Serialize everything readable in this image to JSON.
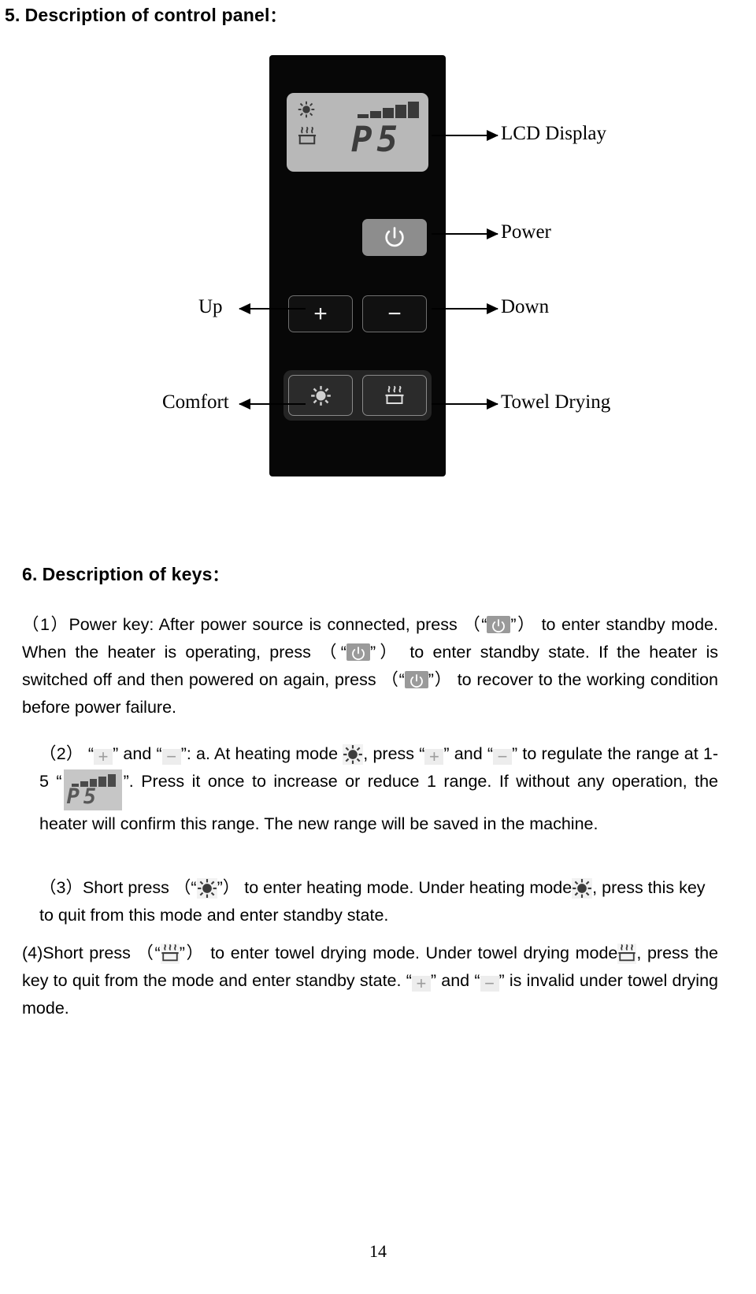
{
  "document": {
    "page_number": "14"
  },
  "sections": {
    "control_panel": {
      "number": "5.",
      "title": "Description of control panel",
      "colon": "：",
      "diagram": {
        "lcd": {
          "readout": "P5",
          "bar_levels": 5,
          "sun_icon": "sun-icon",
          "towel_icon": "towel-drying-icon"
        },
        "buttons": {
          "power": "power-icon",
          "up": "+",
          "down": "−",
          "comfort": "sun-icon",
          "towel": "towel-drying-icon"
        },
        "callouts": {
          "lcd_display": "LCD Display",
          "power": "Power",
          "up": "Up",
          "down": "Down",
          "comfort": "Comfort",
          "towel_drying": "Towel Drying"
        }
      }
    },
    "keys": {
      "number": "6.",
      "title": "Description of keys",
      "colon": "：",
      "items": {
        "item1": {
          "marker": "（1）",
          "t1": "Power key: After power source is connected, press",
          "t2": "（“",
          "t3": "”）",
          "t4": "to enter standby mode. When the heater is operating, press",
          "t5": "（“",
          "t6": "”）",
          "t7": "to enter standby state. If the heater is switched off and then powered on again, press",
          "t8": "（“",
          "t9": "”）",
          "t10": "to recover to the working condition before power failure."
        },
        "item2": {
          "marker": "（2）",
          "t1": "“",
          "t2": "” and “",
          "t3": "”: a. At heating mode",
          "t4": ", press “",
          "t5": "” and “",
          "t6": "” to regulate the range at 1-5 “",
          "t7": "”. Press it once to increase or reduce 1 range. If without any operation, the heater will confirm this range. The new range will be saved in the machine."
        },
        "item3": {
          "marker": "（3）",
          "t1": "Short press",
          "t2": "（“",
          "t3": "”）",
          "t4": "to enter heating mode. Under heating mode",
          "t5": ", press this key to quit from this mode and enter standby state."
        },
        "item4": {
          "marker": "(4)",
          "t1": "Short press",
          "t2": "（“",
          "t3": "”）",
          "t4": "to enter towel drying mode. Under towel drying mode",
          "t5": ",  press the key to quit from the mode and enter standby state. “",
          "t6": "” and “",
          "t7": "” is invalid under towel drying mode."
        }
      }
    }
  }
}
